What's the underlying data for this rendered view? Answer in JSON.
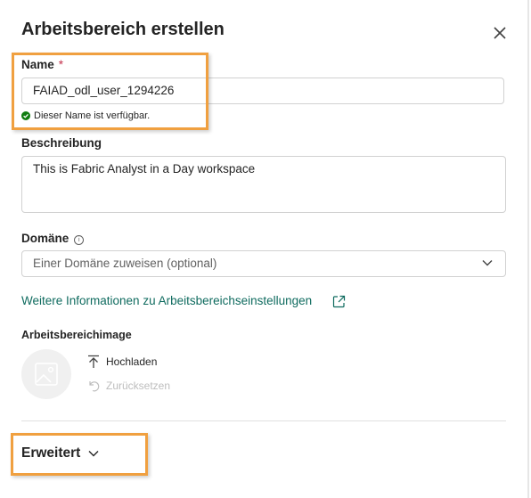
{
  "dialog": {
    "title": "Arbeitsbereich erstellen",
    "close_icon": "close-icon"
  },
  "name": {
    "label": "Name",
    "required_marker": "*",
    "value": "FAIAD_odl_user_1294226",
    "status_text": "Dieser Name ist verfügbar.",
    "status_color": "#107c10"
  },
  "description": {
    "label": "Beschreibung",
    "value": "This is Fabric Analyst in a Day workspace"
  },
  "domain": {
    "label": "Domäne",
    "info_icon": "info-icon",
    "placeholder": "Einer Domäne zuweisen (optional)"
  },
  "more_info": {
    "link_text": "Weitere Informationen zu Arbeitsbereichseinstellungen",
    "icon": "open-external-icon",
    "color": "#0f6b5f"
  },
  "image": {
    "label": "Arbeitsbereichimage",
    "upload_label": "Hochladen",
    "reset_label": "Zurücksetzen"
  },
  "advanced": {
    "label": "Erweitert",
    "icon": "chevron-down-icon"
  },
  "highlight_color": "#f0a040"
}
